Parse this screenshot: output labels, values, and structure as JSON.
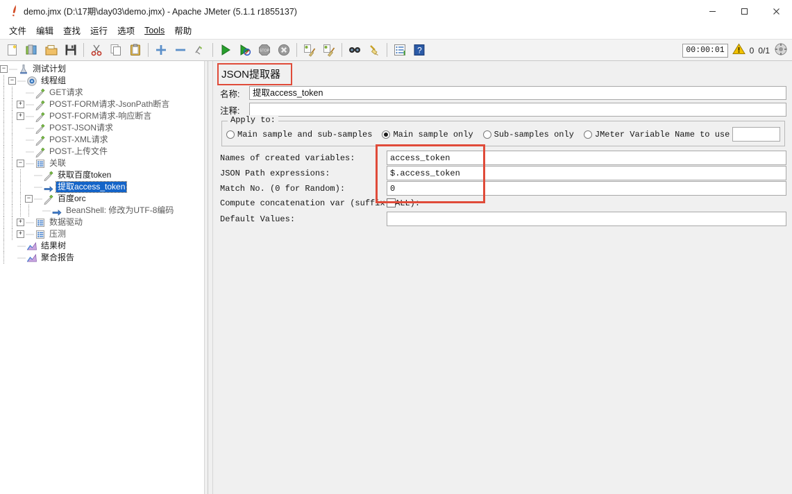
{
  "window": {
    "title": "demo.jmx (D:\\17期\\day03\\demo.jmx) - Apache JMeter (5.1.1 r1855137)",
    "app_icon": "jmeter-feather-icon",
    "minimize": "—",
    "maximize": "☐",
    "close": "✕"
  },
  "menu": [
    {
      "label": "文件",
      "name": "menu-file"
    },
    {
      "label": "编辑",
      "name": "menu-edit"
    },
    {
      "label": "查找",
      "name": "menu-search"
    },
    {
      "label": "运行",
      "name": "menu-run"
    },
    {
      "label": "选项",
      "name": "menu-options"
    },
    {
      "label": "Tools",
      "name": "menu-tools"
    },
    {
      "label": "帮助",
      "name": "menu-help"
    }
  ],
  "toolbar": {
    "buttons": [
      {
        "name": "new-test-plan-icon",
        "title": "New"
      },
      {
        "name": "templates-icon",
        "title": "Templates"
      },
      {
        "name": "open-icon",
        "title": "Open"
      },
      {
        "name": "save-icon",
        "title": "Save"
      },
      {
        "name": "cut-icon",
        "title": "Cut"
      },
      {
        "name": "copy-icon",
        "title": "Copy"
      },
      {
        "name": "paste-icon",
        "title": "Paste"
      },
      {
        "name": "expand-all-icon",
        "title": "Expand all"
      },
      {
        "name": "collapse-all-icon",
        "title": "Collapse all"
      },
      {
        "name": "toggle-icon",
        "title": "Toggle"
      },
      {
        "name": "start-icon",
        "title": "Start"
      },
      {
        "name": "start-no-timers-icon",
        "title": "Start no pauses"
      },
      {
        "name": "stop-icon",
        "title": "Stop"
      },
      {
        "name": "shutdown-icon",
        "title": "Shutdown"
      },
      {
        "name": "clear-icon",
        "title": "Clear"
      },
      {
        "name": "clear-all-icon",
        "title": "Clear all"
      },
      {
        "name": "search-icon",
        "title": "Search"
      },
      {
        "name": "reset-search-icon",
        "title": "Reset Search"
      },
      {
        "name": "function-helper-icon",
        "title": "Function Helper Dialog"
      },
      {
        "name": "help-icon",
        "title": "Help"
      }
    ],
    "status": {
      "timer": "00:00:01",
      "warning_icon": "warning-triangle-icon",
      "warning_count": "0",
      "thread_count": "0/1",
      "gc_icon": "gc-run-icon"
    }
  },
  "tree": {
    "nodes": [
      {
        "label": "测试计划",
        "icon": "test-plan-icon",
        "toggle": "minus",
        "depth": 0,
        "selected": false,
        "dim": false
      },
      {
        "label": "线程组",
        "icon": "thread-group-icon",
        "toggle": "minus",
        "depth": 1,
        "selected": false,
        "dim": false
      },
      {
        "label": "GET请求",
        "icon": "sampler-icon",
        "toggle": "none",
        "depth": 2,
        "selected": false,
        "dim": true
      },
      {
        "label": "POST-FORM请求-JsonPath断言",
        "icon": "sampler-icon",
        "toggle": "plus",
        "depth": 2,
        "selected": false,
        "dim": true
      },
      {
        "label": "POST-FORM请求-响应断言",
        "icon": "sampler-icon",
        "toggle": "plus",
        "depth": 2,
        "selected": false,
        "dim": true
      },
      {
        "label": "POST-JSON请求",
        "icon": "sampler-icon",
        "toggle": "none",
        "depth": 2,
        "selected": false,
        "dim": true
      },
      {
        "label": "POST-XML请求",
        "icon": "sampler-icon",
        "toggle": "none",
        "depth": 2,
        "selected": false,
        "dim": true
      },
      {
        "label": "POST-上传文件",
        "icon": "sampler-icon",
        "toggle": "none",
        "depth": 2,
        "selected": false,
        "dim": true
      },
      {
        "label": "关联",
        "icon": "controller-icon",
        "toggle": "minus",
        "depth": 2,
        "selected": false,
        "dim": true
      },
      {
        "label": "获取百度token",
        "icon": "sampler-icon",
        "toggle": "none",
        "depth": 3,
        "selected": false,
        "dim": false
      },
      {
        "label": "提取access_token",
        "icon": "post-processor-icon",
        "toggle": "none",
        "depth": 3,
        "selected": true,
        "dim": false
      },
      {
        "label": "百度orc",
        "icon": "sampler-icon",
        "toggle": "minus",
        "depth": 3,
        "selected": false,
        "dim": false
      },
      {
        "label": "BeanShell: 修改为UTF-8编码",
        "icon": "post-processor-icon",
        "toggle": "none",
        "depth": 4,
        "selected": false,
        "dim": true
      },
      {
        "label": "数据驱动",
        "icon": "controller-icon",
        "toggle": "plus",
        "depth": 2,
        "selected": false,
        "dim": true
      },
      {
        "label": "压测",
        "icon": "controller-icon",
        "toggle": "plus",
        "depth": 2,
        "selected": false,
        "dim": true
      },
      {
        "label": "结果树",
        "icon": "listener-icon",
        "toggle": "none",
        "depth": 1,
        "selected": false,
        "dim": false
      },
      {
        "label": "聚合报告",
        "icon": "listener-icon",
        "toggle": "none",
        "depth": 1,
        "selected": false,
        "dim": false
      }
    ]
  },
  "panel": {
    "title": "JSON提取器",
    "name_label": "名称:",
    "name_value": "提取access_token",
    "comment_label": "注释:",
    "comment_value": "",
    "apply_to": {
      "legend": "Apply to:",
      "options": [
        {
          "label": "Main sample and sub-samples",
          "selected": false
        },
        {
          "label": "Main sample only",
          "selected": true
        },
        {
          "label": "Sub-samples only",
          "selected": false
        },
        {
          "label": "JMeter Variable Name to use",
          "selected": false
        }
      ],
      "variable_value": ""
    },
    "fields": [
      {
        "label": "Names of created variables:",
        "value": "access_token",
        "type": "text"
      },
      {
        "label": "JSON Path expressions:",
        "value": "$.access_token",
        "type": "text"
      },
      {
        "label": "Match No. (0 for Random):",
        "value": "0",
        "type": "text"
      },
      {
        "label": "Compute concatenation var (suffix _ALL):",
        "value": "",
        "type": "checkbox",
        "checked": false
      },
      {
        "label": "Default Values:",
        "value": "",
        "type": "text"
      }
    ]
  },
  "annotations": {
    "accent_color": "#e04b39",
    "title_box": "JSON提取器 highlighted",
    "fields_box": "created variables / JSON path / match no. highlighted"
  }
}
